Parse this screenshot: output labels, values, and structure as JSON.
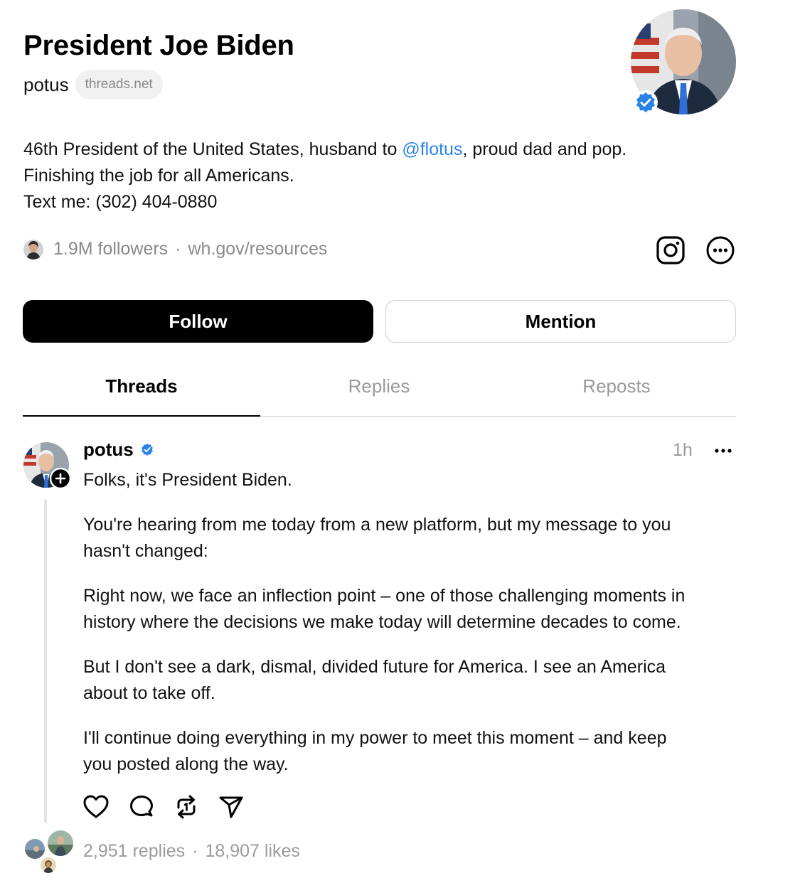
{
  "profile": {
    "name": "President Joe Biden",
    "handle": "potus",
    "domain": "threads.net",
    "bio_lines": [
      {
        "before": "46th President of the United States, husband to ",
        "mention": "@flotus",
        "after": ", proud dad and pop."
      },
      {
        "text": "Finishing the job for all Americans."
      },
      {
        "text": "Text me: (302) 404-0880"
      }
    ],
    "followers": "1.9M followers",
    "link": "wh.gov/resources",
    "separator": "·"
  },
  "buttons": {
    "follow": "Follow",
    "mention": "Mention"
  },
  "tabs": [
    {
      "label": "Threads",
      "active": true
    },
    {
      "label": "Replies",
      "active": false
    },
    {
      "label": "Reposts",
      "active": false
    }
  ],
  "post": {
    "author": "potus",
    "time": "1h",
    "paragraphs": [
      [
        "Folks, it's President Biden."
      ],
      [
        "You're hearing from me today from a new platform, but my message to you",
        "hasn't changed:"
      ],
      [
        "Right now, we face an inflection point – one of those challenging moments in",
        "history where the decisions we make today will determine decades to come."
      ],
      [
        "But I don't see a dark, dismal, divided future for America. I see an America",
        "about to take off."
      ],
      [
        "I'll continue doing everything in my power to meet this moment – and keep",
        "you posted along the way."
      ]
    ],
    "replies": "2,951 replies",
    "likes": "18,907 likes",
    "separator": "·"
  },
  "icons": [
    "verified-badge-icon",
    "instagram-icon",
    "more-circle-icon",
    "follow-plus-icon",
    "more-horizontal-icon",
    "heart-icon",
    "comment-icon",
    "repost-icon",
    "share-icon"
  ],
  "colors": {
    "accent": "#2a83e8",
    "verified": "#2a83e8",
    "muted": "#9a9a9a",
    "follow_bg": "#000000"
  }
}
